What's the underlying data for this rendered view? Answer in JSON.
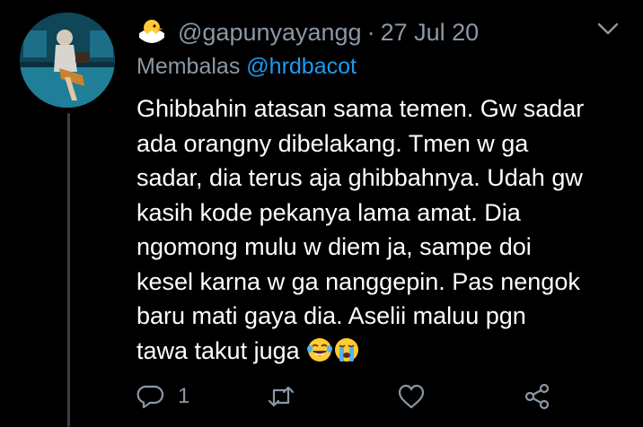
{
  "tweet": {
    "handle": "@gapunyayangg",
    "date": "27 Jul 20",
    "separator": "·",
    "reply_prefix": "Membalas",
    "reply_to": "@hrdbacot",
    "text": "Ghibbahin atasan sama temen. Gw sadar\nada orangny dibelakang. Tmen w ga\nsadar, dia terus aja ghibbahnya. Udah gw\nkasih kode pekanya lama amat. Dia\nngomong mulu w diem ja, sampe doi\nkesel karna w ga nanggepin. Pas nengok\nbaru mati gaya dia. Aselii maluu pgn\ntawa takut juga ",
    "trailing_emojis": [
      "laughing-tears-emoji",
      "crying-emoji"
    ]
  },
  "actions": {
    "reply_count": "1"
  },
  "icons": {
    "display_name_emoji": "hatching-chick-emoji",
    "menu": "chevron-down-icon",
    "reply": "reply-icon",
    "retweet": "retweet-icon",
    "like": "heart-icon",
    "share": "share-icon"
  },
  "colors": {
    "background": "#000000",
    "text": "#ffffff",
    "muted": "#8b98a5",
    "link": "#1d9bf0",
    "thread_line": "#3a3f44"
  }
}
